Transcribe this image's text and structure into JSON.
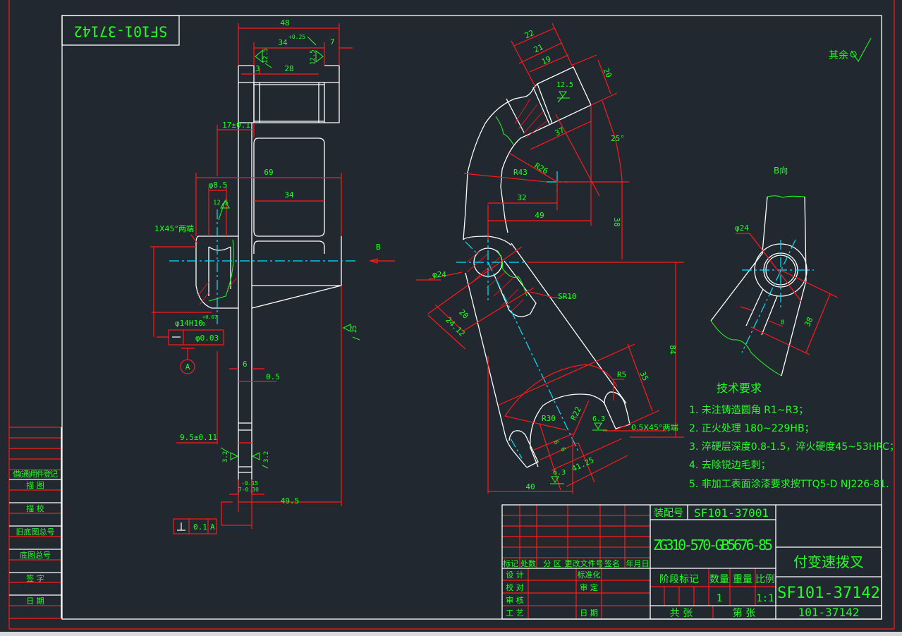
{
  "colors": {
    "background": "#212830",
    "outline": "#ffffff",
    "dimension": "#ff1a1a",
    "text": "#22ff22",
    "centerline": "#00e5ff"
  },
  "stamp": {
    "drawing_no_mirrored": "SF101-37142"
  },
  "surface_note": {
    "label": "其余",
    "symbol": "surface-finish-icon"
  },
  "left_view": {
    "dims": [
      "48",
      "34",
      "+0.25",
      "7",
      "3",
      "28",
      "12.5",
      "12.5",
      "17±0.1",
      "69",
      "φ8.5",
      "12.5",
      "34",
      "1X45°两端",
      "B",
      "φ14H10",
      "+0.07",
      "0",
      "φ0.03",
      "A",
      "6",
      "0.5",
      "9.5±0.11",
      "3.2",
      "3.2",
      "-0.15",
      "7-0.30",
      "49.5",
      "0.1",
      "A",
      "25"
    ]
  },
  "middle_view": {
    "dims": [
      "22",
      "21",
      "19",
      "20",
      "12.5",
      "37",
      "25°",
      "R26",
      "R43",
      "32",
      "49",
      "38",
      "φ24",
      "SR10",
      "20",
      "24.12",
      "84",
      "35",
      "R5",
      "R22",
      "R30",
      "6.3",
      "0.5X45°两端",
      "6",
      "6",
      "6.3",
      "41.25",
      "40"
    ]
  },
  "b_view": {
    "title": "B向",
    "dims": [
      "φ24",
      "8",
      "38"
    ]
  },
  "tech_requirements": {
    "title": "技术要求",
    "items": [
      "1.  未注铸造圆角 R1~R3；",
      "2.  正火处理 180~229HB；",
      "3.  淬硬层深度0.8-1.5，淬火硬度45~53HRC；",
      "4.  去除锐边毛刺；",
      "5.  非加工表面涂漆要求按TTQ5-D NJ226-81."
    ]
  },
  "title_block": {
    "assembly_label": "装配号",
    "assembly_no": "SF101-37001",
    "material": "ZG310-570-GB5676-85",
    "part_name": "付变速拨叉",
    "drawing_no": "SF101-37142",
    "short_no": "101-37142",
    "revision_headers": [
      "标记",
      "处数",
      "分 区",
      "更改文件号",
      "签名",
      "年月日"
    ],
    "sign_rows_left": [
      "设 计",
      "校 对",
      "审 核",
      "工 艺"
    ],
    "sign_rows_mid": [
      "标准化",
      "审 定",
      "",
      "日 期"
    ],
    "stage_label": "阶段标记",
    "quantity_label": "数量",
    "weight_label": "重量",
    "scale_label": "比例",
    "quantity": "1",
    "scale": "1:1",
    "sheets_total_label": "共    张",
    "sheet_no_label": "第    张"
  },
  "side_table": {
    "labels": [
      "借(通)用件登记",
      "描  图",
      "描  校",
      "旧底图总号",
      "底图总号",
      "签  字",
      "日  期"
    ]
  }
}
